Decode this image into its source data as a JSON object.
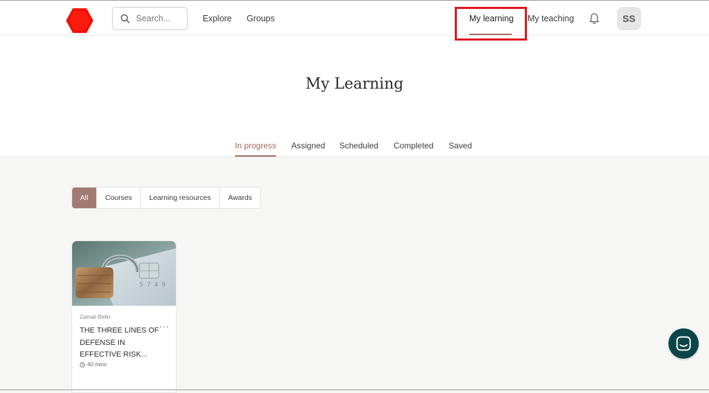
{
  "header": {
    "search_placeholder": "Search...",
    "nav": [
      {
        "label": "Explore"
      },
      {
        "label": "Groups"
      },
      {
        "label": "My learning"
      },
      {
        "label": "My teaching"
      }
    ],
    "avatar_initials": "SS",
    "icons": {
      "logo": "hexagon-logo-icon",
      "search": "search-icon",
      "bell": "bell-icon"
    },
    "brand_color": "#ff0000"
  },
  "main": {
    "title": "My Learning",
    "tabs": [
      {
        "label": "In progress"
      },
      {
        "label": "Assigned"
      },
      {
        "label": "Scheduled"
      },
      {
        "label": "Completed"
      },
      {
        "label": "Saved"
      }
    ],
    "filters": [
      {
        "label": "All"
      },
      {
        "label": "Courses"
      },
      {
        "label": "Learning resources"
      },
      {
        "label": "Awards"
      }
    ],
    "cards": [
      {
        "author": "Zainab Bello",
        "title": "THE THREE LINES OF DEFENSE IN EFFECTIVE RISK...",
        "duration": "40 mins",
        "menu": "···",
        "thumbnail": "padlock-on-credit-card-image"
      }
    ]
  },
  "accent_color": "#a56d67",
  "chat_color": "#0b4548"
}
